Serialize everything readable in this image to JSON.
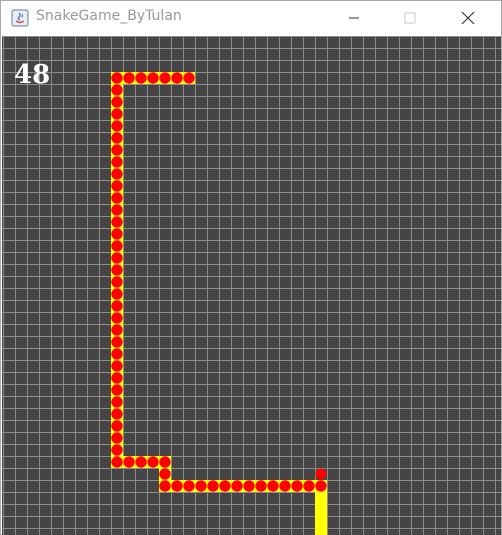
{
  "window": {
    "title": "SnakeGame_ByTulan",
    "controls": [
      "minimize",
      "maximize",
      "close"
    ]
  },
  "game": {
    "score": "48",
    "colors": {
      "background": "#454545",
      "grid": "#8c8c8c",
      "snake_body": "#ff0000",
      "snake_outline": "#ffff00",
      "apple": "#ff0000"
    },
    "cell_size": 12,
    "snake": [
      [
        10,
        3
      ],
      [
        11,
        3
      ],
      [
        12,
        3
      ],
      [
        13,
        3
      ],
      [
        14,
        3
      ],
      [
        15,
        3
      ],
      [
        9,
        3
      ],
      [
        9,
        4
      ],
      [
        9,
        5
      ],
      [
        9,
        6
      ],
      [
        9,
        7
      ],
      [
        9,
        8
      ],
      [
        9,
        9
      ],
      [
        9,
        10
      ],
      [
        9,
        11
      ],
      [
        9,
        12
      ],
      [
        9,
        13
      ],
      [
        9,
        14
      ],
      [
        9,
        15
      ],
      [
        9,
        16
      ],
      [
        9,
        17
      ],
      [
        9,
        18
      ],
      [
        9,
        19
      ],
      [
        9,
        20
      ],
      [
        9,
        21
      ],
      [
        9,
        22
      ],
      [
        9,
        23
      ],
      [
        9,
        24
      ],
      [
        9,
        25
      ],
      [
        9,
        26
      ],
      [
        9,
        27
      ],
      [
        9,
        28
      ],
      [
        9,
        29
      ],
      [
        9,
        30
      ],
      [
        9,
        31
      ],
      [
        9,
        32
      ],
      [
        9,
        33
      ],
      [
        9,
        34
      ],
      [
        9,
        35
      ],
      [
        10,
        35
      ],
      [
        11,
        35
      ],
      [
        12,
        35
      ],
      [
        13,
        35
      ],
      [
        13,
        36
      ],
      [
        13,
        37
      ],
      [
        14,
        37
      ],
      [
        15,
        37
      ],
      [
        16,
        37
      ],
      [
        17,
        37
      ],
      [
        18,
        37
      ],
      [
        19,
        37
      ],
      [
        20,
        37
      ],
      [
        21,
        37
      ],
      [
        22,
        37
      ],
      [
        23,
        37
      ],
      [
        24,
        37
      ],
      [
        25,
        37
      ],
      [
        26,
        37
      ]
    ],
    "apple": [
      26,
      36
    ],
    "yellow_tail": {
      "col": 26,
      "from_row": 38,
      "to_row": 41
    }
  }
}
